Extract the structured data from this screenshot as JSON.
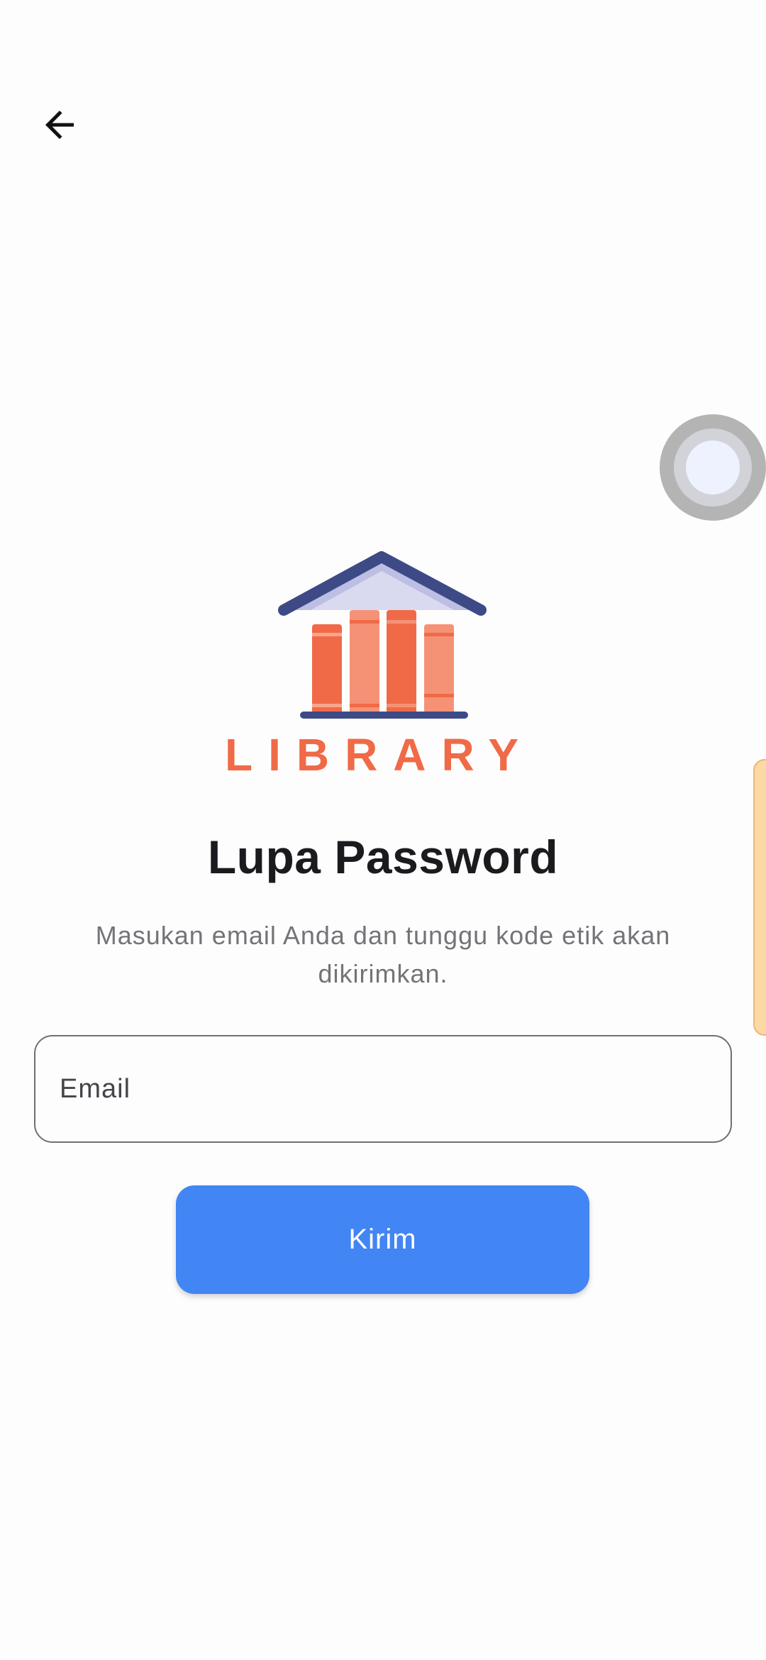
{
  "header": {
    "back_icon": "arrow-left-icon"
  },
  "logo": {
    "text": "LIBRARY",
    "colors": {
      "roof": "#3d4a86",
      "roof_inner": "#bcbfe3",
      "book_dark": "#f06a47",
      "book_light": "#f59276",
      "text": "#f06a47"
    }
  },
  "title": "Lupa Password",
  "subtitle": "Masukan email Anda dan tunggu kode etik akan dikirimkan.",
  "email_input": {
    "placeholder": "Email",
    "value": ""
  },
  "submit_button": {
    "label": "Kirim",
    "color": "#4285f4"
  },
  "overlay": {
    "assistive_touch_icon": "assistive-touch-icon",
    "edge_handle_color": "#fcd8a4"
  }
}
